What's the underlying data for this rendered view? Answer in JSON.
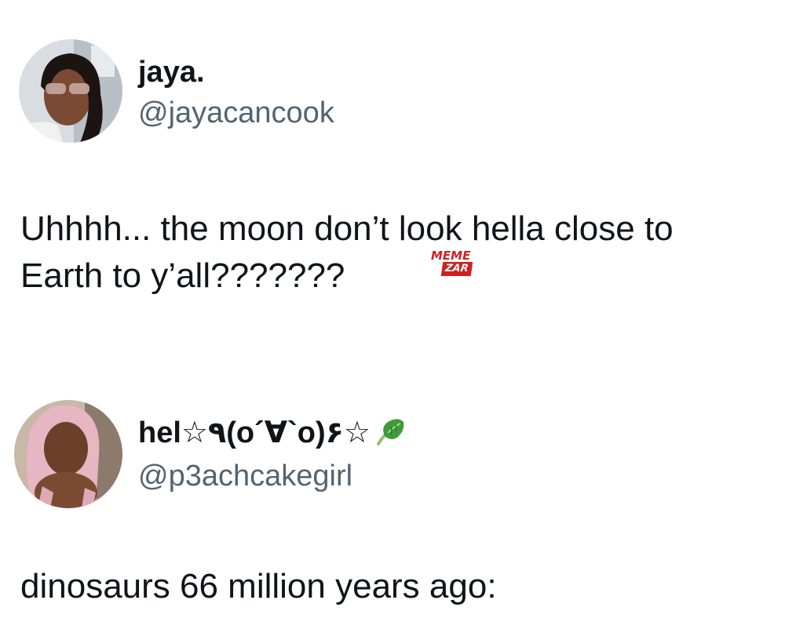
{
  "tweets": [
    {
      "display_name": "jaya.",
      "handle": "@jayacancook",
      "text": "Uhhhh... the moon don’t look hella close to Earth to y’all???????"
    },
    {
      "display_name": "hel☆٩(o´∀`o)۶☆",
      "name_emoji": "lettuce-icon",
      "handle": "@p3achcakegirl",
      "text": "dinosaurs 66 million years ago:"
    }
  ],
  "watermark": {
    "line1": "MEME",
    "line2": "ZAR",
    "color": "#d12020"
  },
  "colors": {
    "text": "#0f1419",
    "handle": "#536471",
    "background": "#ffffff"
  }
}
